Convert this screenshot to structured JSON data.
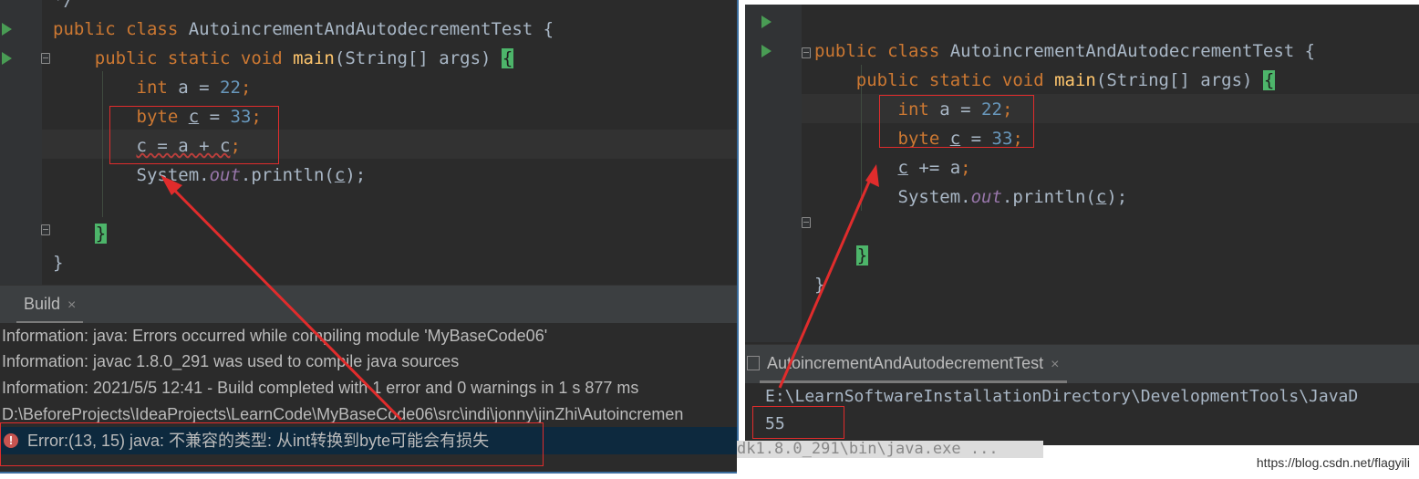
{
  "left_editor": {
    "lines": [
      {
        "n": 0,
        "parts": [
          {
            "t": "*/",
            "c": "cm"
          }
        ]
      },
      {
        "n": 1,
        "parts": [
          {
            "t": "public class ",
            "c": "kw"
          },
          {
            "t": "AutoincrementAndAutodecrementTest",
            "c": "pl"
          },
          {
            "t": " {",
            "c": "pl"
          }
        ]
      },
      {
        "n": 2,
        "parts": [
          {
            "t": "    public static void ",
            "c": "kw"
          },
          {
            "t": "main",
            "c": "fn"
          },
          {
            "t": "(String[] args) ",
            "c": "pl"
          },
          {
            "t": "{",
            "c": "bg"
          }
        ]
      },
      {
        "n": 3,
        "parts": [
          {
            "t": "        int ",
            "c": "kw"
          },
          {
            "t": "a = ",
            "c": "pl"
          },
          {
            "t": "22",
            "c": "num"
          },
          {
            "t": ";",
            "c": "sep"
          }
        ]
      },
      {
        "n": 4,
        "parts": [
          {
            "t": "        byte ",
            "c": "kw"
          },
          {
            "t": "c",
            "c": "ul"
          },
          {
            "t": " = ",
            "c": "pl"
          },
          {
            "t": "33",
            "c": "num"
          },
          {
            "t": ";",
            "c": "sep"
          }
        ]
      },
      {
        "n": 5,
        "parts": [
          {
            "t": "        ",
            "c": "pl"
          },
          {
            "t": "c = a + c",
            "c": "sq"
          },
          {
            "t": ";",
            "c": "sep"
          }
        ]
      },
      {
        "n": 6,
        "parts": [
          {
            "t": "        System.",
            "c": "pl"
          },
          {
            "t": "out",
            "c": "field"
          },
          {
            "t": ".println(",
            "c": "pl"
          },
          {
            "t": "c",
            "c": "ul"
          },
          {
            "t": ");",
            "c": "pl"
          }
        ]
      },
      {
        "n": 7,
        "parts": []
      },
      {
        "n": 8,
        "parts": [
          {
            "t": "    ",
            "c": "pl"
          },
          {
            "t": "}",
            "c": "bg"
          }
        ]
      },
      {
        "n": 9,
        "parts": [
          {
            "t": "}",
            "c": "pl"
          }
        ]
      }
    ]
  },
  "build": {
    "tab_label": "Build",
    "close_glyph": "×",
    "lines": [
      "Information: java: Errors occurred while compiling module 'MyBaseCode06'",
      "Information: javac 1.8.0_291 was used to compile java sources",
      "Information: 2021/5/5 12:41 - Build completed with 1 error and 0 warnings in 1 s 877 ms",
      "D:\\BeforeProjects\\IdeaProjects\\LearnCode\\MyBaseCode06\\src\\indi\\jonny\\jinZhi\\Autoincremen"
    ],
    "error": "Error:(13, 15)  java: 不兼容的类型: 从int转换到byte可能会有损失",
    "error_icon": "!"
  },
  "right_editor": {
    "lines": [
      {
        "n": 1,
        "parts": [
          {
            "t": "public class ",
            "c": "kw"
          },
          {
            "t": "AutoincrementAndAutodecrementTest",
            "c": "pl"
          },
          {
            "t": " {",
            "c": "pl"
          }
        ]
      },
      {
        "n": 2,
        "parts": [
          {
            "t": "    public static void ",
            "c": "kw"
          },
          {
            "t": "main",
            "c": "fn"
          },
          {
            "t": "(String[] args) ",
            "c": "pl"
          },
          {
            "t": "{",
            "c": "bg"
          }
        ]
      },
      {
        "n": 3,
        "parts": [
          {
            "t": "        int ",
            "c": "kw"
          },
          {
            "t": "a = ",
            "c": "pl"
          },
          {
            "t": "22",
            "c": "num"
          },
          {
            "t": ";",
            "c": "sep"
          }
        ]
      },
      {
        "n": 4,
        "parts": [
          {
            "t": "        byte ",
            "c": "kw"
          },
          {
            "t": "c",
            "c": "ul"
          },
          {
            "t": " = ",
            "c": "pl"
          },
          {
            "t": "33",
            "c": "num"
          },
          {
            "t": ";",
            "c": "sep"
          }
        ]
      },
      {
        "n": 5,
        "parts": [
          {
            "t": "        ",
            "c": "pl"
          },
          {
            "t": "c",
            "c": "ul"
          },
          {
            "t": " += a",
            "c": "pl"
          },
          {
            "t": ";",
            "c": "sep"
          }
        ]
      },
      {
        "n": 6,
        "parts": [
          {
            "t": "        System.",
            "c": "pl"
          },
          {
            "t": "out",
            "c": "field"
          },
          {
            "t": ".println(",
            "c": "pl"
          },
          {
            "t": "c",
            "c": "ul"
          },
          {
            "t": ");",
            "c": "pl"
          }
        ]
      },
      {
        "n": 7,
        "parts": []
      },
      {
        "n": 8,
        "parts": [
          {
            "t": "    ",
            "c": "pl"
          },
          {
            "t": "}",
            "c": "bg"
          }
        ]
      },
      {
        "n": 9,
        "parts": [
          {
            "t": "}",
            "c": "pl"
          }
        ]
      }
    ]
  },
  "run": {
    "tab_label": "AutoincrementAndAutodecrementTest",
    "close_glyph": "×",
    "command": "E:\\LearnSoftwareInstallationDirectory\\DevelopmentTools\\JavaD",
    "output": "55",
    "overlap_text": "dk1.8.0_291\\bin\\java.exe ..."
  },
  "watermark": "https://blog.csdn.net/flagyili",
  "colors": {
    "annotation": "#e02c2c",
    "error_row": "#0d293e",
    "brace_match": "#4db56a"
  }
}
